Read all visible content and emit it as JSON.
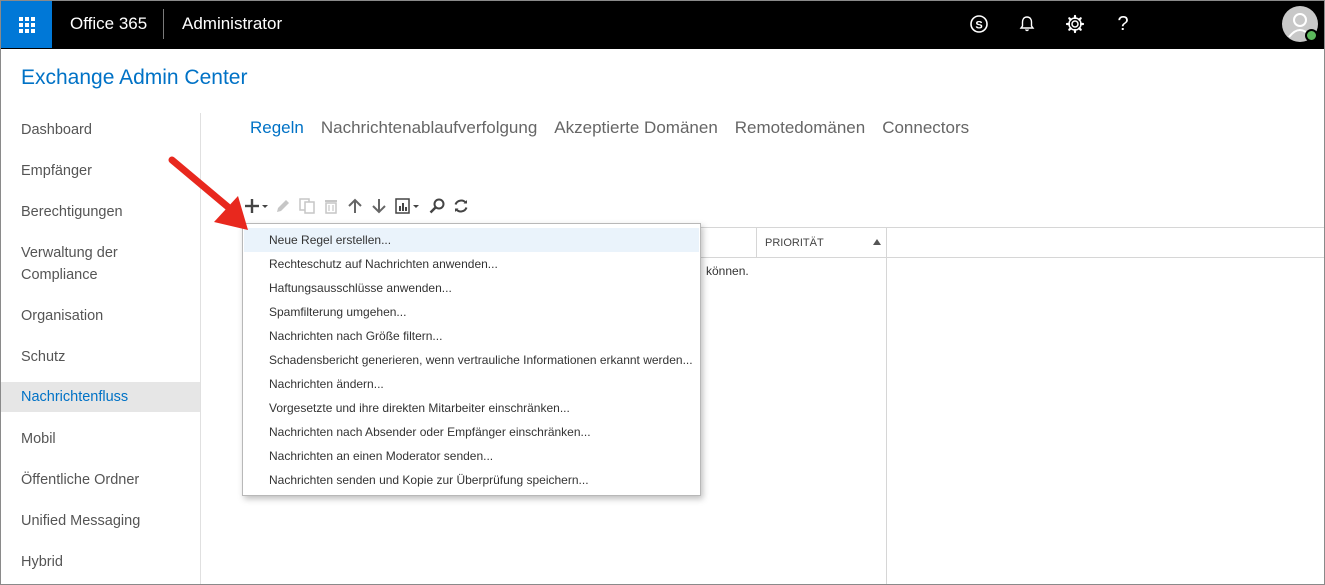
{
  "topbar": {
    "brand": "Office 365",
    "app_name": "Administrator",
    "help_label": "?"
  },
  "page": {
    "title": "Exchange Admin Center"
  },
  "sidebar": {
    "items": [
      {
        "label": "Dashboard"
      },
      {
        "label": "Empfänger"
      },
      {
        "label": "Berechtigungen"
      },
      {
        "label": "Verwaltung der Compliance"
      },
      {
        "label": "Organisation"
      },
      {
        "label": "Schutz"
      },
      {
        "label": "Nachrichtenfluss",
        "active": true
      },
      {
        "label": "Mobil"
      },
      {
        "label": "Öffentliche Ordner"
      },
      {
        "label": "Unified Messaging"
      },
      {
        "label": "Hybrid"
      }
    ]
  },
  "tabs": [
    {
      "label": "Regeln",
      "active": true
    },
    {
      "label": "Nachrichtenablaufverfolgung"
    },
    {
      "label": "Akzeptierte Domänen"
    },
    {
      "label": "Remotedomänen"
    },
    {
      "label": "Connectors"
    }
  ],
  "toolbar": {
    "icons": [
      "add-icon",
      "edit-icon",
      "copy-icon",
      "delete-icon",
      "move-up-icon",
      "move-down-icon",
      "export-icon",
      "search-icon",
      "refresh-icon"
    ]
  },
  "grid": {
    "priority_header": "PRIORITÄT",
    "empty_text_fragment": "können."
  },
  "menu": {
    "items": [
      "Neue Regel erstellen...",
      "Rechteschutz auf Nachrichten anwenden...",
      "Haftungsausschlüsse anwenden...",
      "Spamfilterung umgehen...",
      "Nachrichten nach Größe filtern...",
      "Schadensbericht generieren, wenn vertrauliche Informationen erkannt werden...",
      "Nachrichten ändern...",
      "Vorgesetzte und ihre direkten Mitarbeiter einschränken...",
      "Nachrichten nach Absender oder Empfänger einschränken...",
      "Nachrichten an einen Moderator senden...",
      "Nachrichten senden und Kopie zur Überprüfung speichern..."
    ]
  },
  "colors": {
    "accent": "#0072c6",
    "waffle": "#0078d7",
    "annotation_arrow": "#e8281e"
  }
}
